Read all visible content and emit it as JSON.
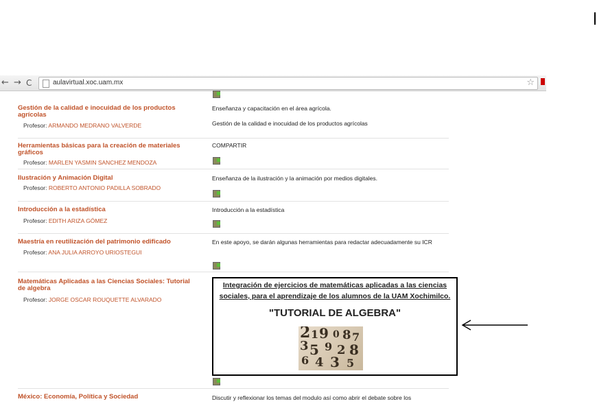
{
  "browser": {
    "nav_back": "←",
    "nav_forward": "→",
    "nav_reload": "C",
    "url": "aulavirtual.xoc.uam.mx",
    "star": "☆"
  },
  "courses": [
    {
      "title": "Gestión de la calidad e inocuidad de los productos agrícolas",
      "professor_label": "Profesor:",
      "professor": "ARMANDO MEDRANO VALVERDE",
      "desc1": "Enseñanza y capacitación en el área agrícola.",
      "desc2": "Gestión de la calidad e inocuidad de los productos agrícolas"
    },
    {
      "title": "Herramientas básicas para la creación de materiales gráficos",
      "professor_label": "Profesor:",
      "professor": "MARLEN YASMIN SANCHEZ MENDOZA",
      "desc1": "COMPARTIR"
    },
    {
      "title": "Ilustración y Animación Digital",
      "professor_label": "Profesor:",
      "professor": "ROBERTO ANTONIO PADILLA SOBRADO",
      "desc1": "Enseñanza de la ilustración y la animación por medios digitales."
    },
    {
      "title": "Introducción a la estadística",
      "professor_label": "Profesor:",
      "professor": "EDITH ARIZA GÓMEZ",
      "desc1": "Introducción a la estadística"
    },
    {
      "title": "Maestría en reutilización del patrimonio edificado",
      "professor_label": "Profesor:",
      "professor": "ANA JULIA ARROYO URIOSTEGUI",
      "desc1": "En este apoyo, se darán algunas herramientas para redactar adecuadamente su ICR"
    },
    {
      "title": "Matemáticas Aplicadas a las Ciencias Sociales: Tutorial de algebra",
      "professor_label": "Profesor:",
      "professor": "JORGE OSCAR ROUQUETTE ALVARADO"
    },
    {
      "title": "México: Economía, Política y Sociedad",
      "desc1": "Discutir y reflexionar los temas del modulo así como abrir el debate sobre los"
    }
  ],
  "promo": {
    "text": "Integración de ejercicios de matemáticas aplicadas a las ciencias sociales, para el aprendizaje de los alumnos de la UAM Xochimilco.",
    "title": "\"TUTORIAL DE ALGEBRA\"",
    "digits": [
      "2",
      "1",
      "9",
      "0",
      "8",
      "7",
      "3",
      "5",
      "9",
      "2",
      "8",
      "6",
      "4",
      "3",
      "5"
    ]
  }
}
